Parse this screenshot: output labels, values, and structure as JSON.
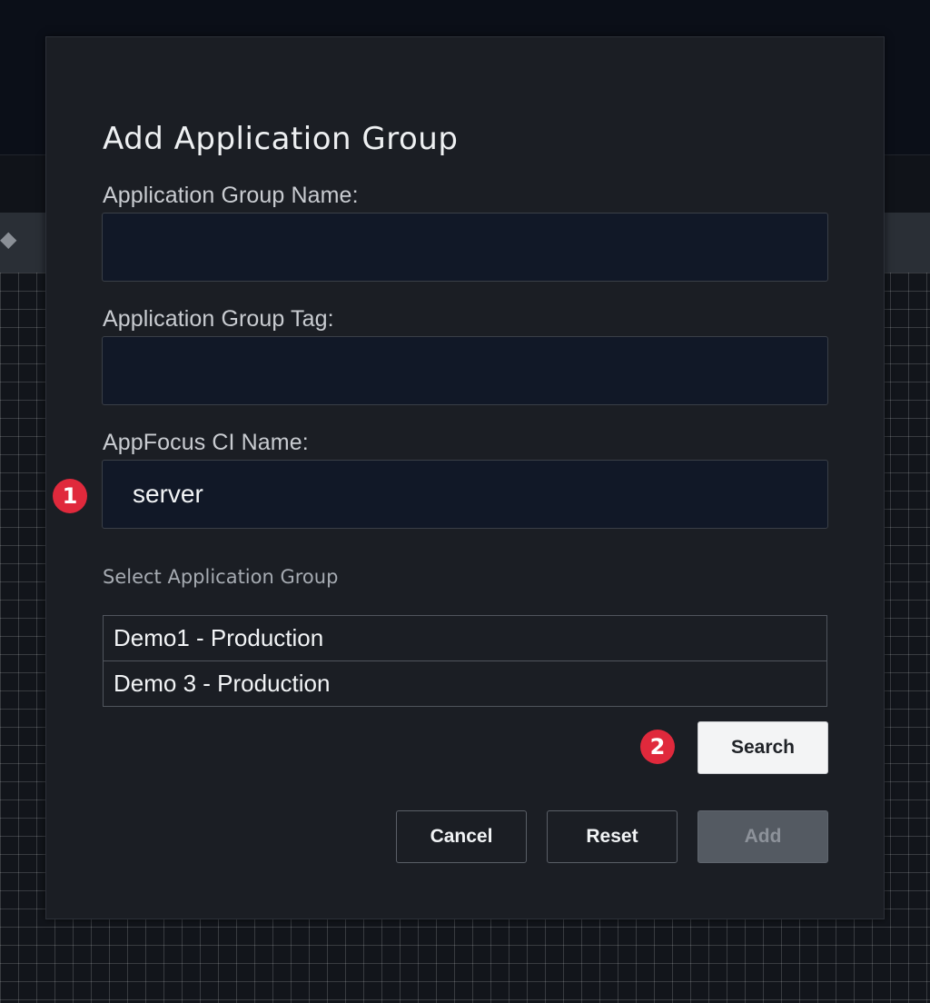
{
  "dialog": {
    "title": "Add Application Group",
    "fields": {
      "name": {
        "label": "Application Group Name:",
        "value": ""
      },
      "tag": {
        "label": "Application Group Tag:",
        "value": ""
      },
      "ci_name": {
        "label": "AppFocus CI Name:",
        "value": "server"
      }
    },
    "select_label": "Select Application Group",
    "groups": [
      "Demo1 - Production",
      "Demo 3 - Production"
    ],
    "buttons": {
      "search": "Search",
      "cancel": "Cancel",
      "reset": "Reset",
      "add": "Add"
    }
  },
  "annotations": {
    "step1": "1",
    "step2": "2"
  },
  "colors": {
    "annotation_badge": "#e0293c",
    "input_bg": "#111827",
    "modal_bg": "#1b1e24"
  },
  "icons": {
    "toolbar_left": "diamond-icon"
  }
}
